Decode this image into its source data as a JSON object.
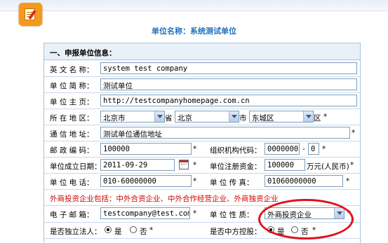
{
  "header": {
    "unit_name_label": "单位名称：系统测试单位",
    "icon": "notepad-pen-icon"
  },
  "section": {
    "title": "一、申报单位信息："
  },
  "fields": {
    "english_name": {
      "label": "英 文 名 称：",
      "value": "system test company"
    },
    "short_name": {
      "label": "单 位 简 称：",
      "value": "测试单位"
    },
    "homepage": {
      "label": "单 位 主 页：",
      "value": "http://testcompanyhomepage.com.cn"
    },
    "region": {
      "label": "所 在 地 区：",
      "province": "北京市",
      "province_suffix": "省",
      "city": "北京",
      "city_suffix": "市",
      "district": "东城区",
      "district_suffix": "区",
      "required": "*"
    },
    "address": {
      "label": "通 信 地 址：",
      "value": "测试单位通信地址",
      "required": "*"
    },
    "postcode": {
      "label": "邮 政 编 码：",
      "value": "100000",
      "required": "*"
    },
    "org_code": {
      "label": "组织机构代码：",
      "value": "0000000",
      "dash": "-",
      "check": "0",
      "required": "*"
    },
    "founded": {
      "label": "单位成立日期：",
      "value": "2011-09-29",
      "required": "*"
    },
    "capital": {
      "label": "单位注册资金：",
      "value": "100000",
      "unit": "万元(人民币)",
      "required": "*"
    },
    "phone": {
      "label": "单 位 电 话：",
      "value": "010-60000000",
      "required": "*"
    },
    "fax": {
      "label": "单 位 传 真：",
      "value": "01060000000",
      "required": "*"
    },
    "foreign_note": "外商投资企业包括：中外合资企业、中外合作经营企业、外商独资企业",
    "email": {
      "label": "电 子 邮 箱：",
      "value": "testcompany@test.com",
      "required": "*"
    },
    "nature": {
      "label": "单 位 性 质：",
      "value": "外商投资企业",
      "required": "*"
    },
    "independent_legal": {
      "label": "是否独立法人：",
      "yes": "是",
      "no": "否",
      "required": "*",
      "selected": "yes"
    },
    "chinese_control": {
      "label": "是否中方控股：",
      "yes": "是",
      "no": "否",
      "required": "*",
      "selected": "yes"
    }
  },
  "colors": {
    "title_blue": "#1f6fb9",
    "note_red": "#d00000",
    "highlight_red": "#e0101a",
    "icon_orange": "#f39a1e"
  }
}
